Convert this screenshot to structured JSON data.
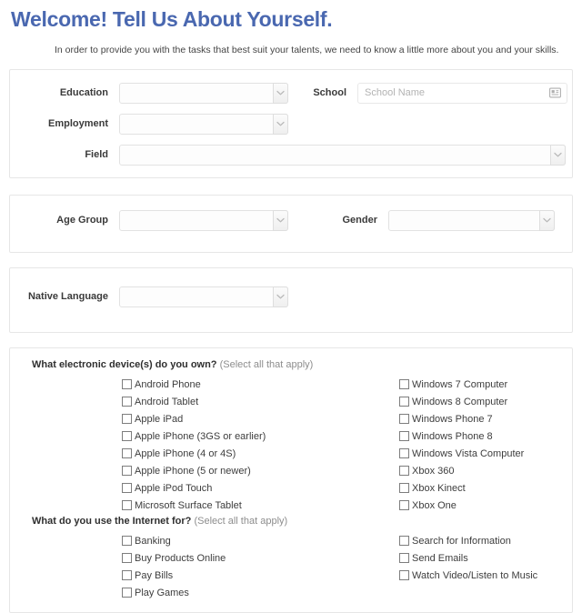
{
  "header": {
    "title": "Welcome! Tell Us About Yourself.",
    "subtitle": "In order to provide you with the tasks that best suit your talents, we need to know a little more about you and your skills."
  },
  "icons": {
    "chevron_down": "chevron-down-icon",
    "address_card": "address-card-icon"
  },
  "panels": {
    "education": {
      "fields": {
        "education": {
          "label": "Education",
          "value": "",
          "type": "select"
        },
        "school": {
          "label": "School",
          "value": "",
          "placeholder": "School Name",
          "type": "text"
        },
        "employment": {
          "label": "Employment",
          "value": "",
          "type": "select"
        },
        "field": {
          "label": "Field",
          "value": "",
          "type": "select"
        }
      }
    },
    "demographics": {
      "fields": {
        "age_group": {
          "label": "Age Group",
          "value": "",
          "type": "select"
        },
        "gender": {
          "label": "Gender",
          "value": "",
          "type": "select"
        }
      }
    },
    "language": {
      "fields": {
        "native_language": {
          "label": "Native Language",
          "value": "",
          "type": "select"
        }
      }
    },
    "devices": {
      "title": "What electronic device(s) do you own?",
      "hint": "(Select all that apply)",
      "left_column": [
        {
          "label": "Android Phone",
          "checked": false
        },
        {
          "label": "Android Tablet",
          "checked": false
        },
        {
          "label": "Apple iPad",
          "checked": false
        },
        {
          "label": "Apple iPhone (3GS or earlier)",
          "checked": false
        },
        {
          "label": "Apple iPhone (4 or 4S)",
          "checked": false
        },
        {
          "label": "Apple iPhone (5 or newer)",
          "checked": false
        },
        {
          "label": "Apple iPod Touch",
          "checked": false
        },
        {
          "label": "Microsoft Surface Tablet",
          "checked": false
        }
      ],
      "right_column": [
        {
          "label": "Windows 7 Computer",
          "checked": false
        },
        {
          "label": "Windows 8 Computer",
          "checked": false
        },
        {
          "label": "Windows Phone 7",
          "checked": false
        },
        {
          "label": "Windows Phone 8",
          "checked": false
        },
        {
          "label": "Windows Vista Computer",
          "checked": false
        },
        {
          "label": "Xbox 360",
          "checked": false
        },
        {
          "label": "Xbox Kinect",
          "checked": false
        },
        {
          "label": "Xbox One",
          "checked": false
        }
      ]
    },
    "internet": {
      "title": "What do you use the Internet for?",
      "hint": "(Select all that apply)",
      "left_column": [
        {
          "label": "Banking",
          "checked": false
        },
        {
          "label": "Buy Products Online",
          "checked": false
        },
        {
          "label": "Pay Bills",
          "checked": false
        },
        {
          "label": "Play Games",
          "checked": false
        }
      ],
      "right_column": [
        {
          "label": "Search for Information",
          "checked": false
        },
        {
          "label": "Send Emails",
          "checked": false
        },
        {
          "label": "Watch Video/Listen to Music",
          "checked": false
        }
      ]
    }
  },
  "colors": {
    "title_blue": "#4a68b0",
    "panel_border": "#e6e6e6",
    "input_border": "#e2e2e2",
    "placeholder": "#b3b3b3"
  }
}
